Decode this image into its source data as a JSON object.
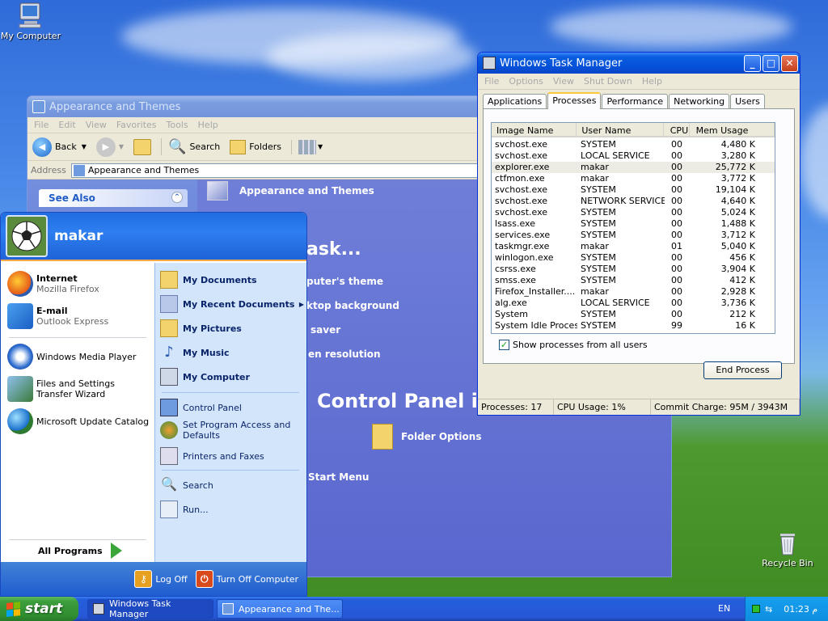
{
  "desktop": {
    "icons": [
      {
        "label": "My Computer"
      },
      {
        "label": "Recycle Bin"
      }
    ]
  },
  "task_manager": {
    "title": "Windows Task Manager",
    "menu": [
      "File",
      "Options",
      "View",
      "Shut Down",
      "Help"
    ],
    "tabs": [
      "Applications",
      "Processes",
      "Performance",
      "Networking",
      "Users"
    ],
    "active_tab": "Processes",
    "columns": [
      "Image Name",
      "User Name",
      "CPU",
      "Mem Usage"
    ],
    "rows": [
      [
        "svchost.exe",
        "SYSTEM",
        "00",
        "4,480 K"
      ],
      [
        "svchost.exe",
        "LOCAL SERVICE",
        "00",
        "3,280 K"
      ],
      [
        "explorer.exe",
        "makar",
        "00",
        "25,772 K"
      ],
      [
        "ctfmon.exe",
        "makar",
        "00",
        "3,772 K"
      ],
      [
        "svchost.exe",
        "SYSTEM",
        "00",
        "19,104 K"
      ],
      [
        "svchost.exe",
        "NETWORK SERVICE",
        "00",
        "4,640 K"
      ],
      [
        "svchost.exe",
        "SYSTEM",
        "00",
        "5,024 K"
      ],
      [
        "lsass.exe",
        "SYSTEM",
        "00",
        "1,488 K"
      ],
      [
        "services.exe",
        "SYSTEM",
        "00",
        "3,712 K"
      ],
      [
        "taskmgr.exe",
        "makar",
        "01",
        "5,040 K"
      ],
      [
        "winlogon.exe",
        "SYSTEM",
        "00",
        "456 K"
      ],
      [
        "csrss.exe",
        "SYSTEM",
        "00",
        "3,904 K"
      ],
      [
        "smss.exe",
        "SYSTEM",
        "00",
        "412 K"
      ],
      [
        "Firefox_Installer....",
        "makar",
        "00",
        "2,928 K"
      ],
      [
        "alg.exe",
        "LOCAL SERVICE",
        "00",
        "3,736 K"
      ],
      [
        "System",
        "SYSTEM",
        "00",
        "212 K"
      ],
      [
        "System Idle Process",
        "SYSTEM",
        "99",
        "16 K"
      ]
    ],
    "show_all_label": "Show processes from all users",
    "end_process_label": "End Process",
    "status": {
      "processes": "Processes: 17",
      "cpu": "CPU Usage: 1%",
      "commit": "Commit Charge: 95M / 3943M"
    },
    "min": "_",
    "max": "□",
    "close": "✕"
  },
  "appearance": {
    "title": "Appearance and Themes",
    "menu": [
      "File",
      "Edit",
      "View",
      "Favorites",
      "Tools",
      "Help"
    ],
    "toolbar": {
      "back": "Back",
      "search": "Search",
      "folders": "Folders"
    },
    "address_label": "Address",
    "address_value": "Appearance and Themes",
    "see_also": "See Also",
    "header": "Appearance and Themes",
    "pick_task": "ask...",
    "tasks": [
      "puter's theme",
      "ktop background",
      "saver",
      "en resolution"
    ],
    "pick_icon": "Control Panel ic",
    "folder_options": "Folder Options",
    "start_menu": "Start Menu"
  },
  "start_menu": {
    "user": "makar",
    "pinned": [
      {
        "title": "Internet",
        "sub": "Mozilla Firefox"
      },
      {
        "title": "E-mail",
        "sub": "Outlook Express"
      }
    ],
    "recent": [
      "Windows Media Player",
      "Files and Settings Transfer Wizard",
      "Microsoft Update Catalog"
    ],
    "all_programs": "All Programs",
    "right": {
      "my_documents": "My Documents",
      "my_recent_documents": "My Recent Documents",
      "my_pictures": "My Pictures",
      "my_music": "My Music",
      "my_computer": "My Computer",
      "control_panel": "Control Panel",
      "set_program_access": "Set Program Access and Defaults",
      "printers": "Printers and Faxes",
      "search": "Search",
      "run": "Run..."
    },
    "log_off": "Log Off",
    "turn_off": "Turn Off Computer"
  },
  "taskbar": {
    "start": "start",
    "tasks": [
      "Windows Task Manager",
      "Appearance and The..."
    ],
    "language": "EN",
    "clock": "01:23 م"
  }
}
